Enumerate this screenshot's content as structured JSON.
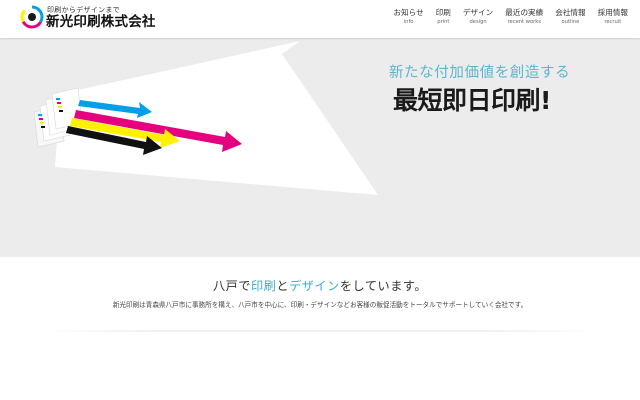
{
  "header": {
    "logo": {
      "tagline": "印刷からデザインまで",
      "name": "新光印刷株式会社",
      "colors": [
        "#00a0e9",
        "#e4007f",
        "#fff100"
      ]
    },
    "nav": [
      {
        "label": "お知らせ",
        "sub": "info"
      },
      {
        "label": "印刷",
        "sub": "print"
      },
      {
        "label": "デザイン",
        "sub": "design"
      },
      {
        "label": "最近の実績",
        "sub": "recent works"
      },
      {
        "label": "会社情報",
        "sub": "outline"
      },
      {
        "label": "採用情報",
        "sub": "recruit"
      }
    ]
  },
  "hero": {
    "subtitle": "新たな付加価値を創造する",
    "title": "最短即日印刷!",
    "stripe_colors": {
      "cyan": "#00a0e9",
      "magenta": "#e4007f",
      "yellow": "#fff100",
      "black": "#111111"
    }
  },
  "intro": {
    "heading": {
      "part1": "八戸で",
      "accent1": "印刷",
      "part2": "と",
      "accent2": "デザイン",
      "part3": "をしています。"
    },
    "text": "新光印刷は青森県八戸市に事務所を構え、八戸市を中心に、印刷・デザインなどお客様の販促活動をトータルでサポートしていく会社です。",
    "accent_color": "#3aa8d8"
  }
}
